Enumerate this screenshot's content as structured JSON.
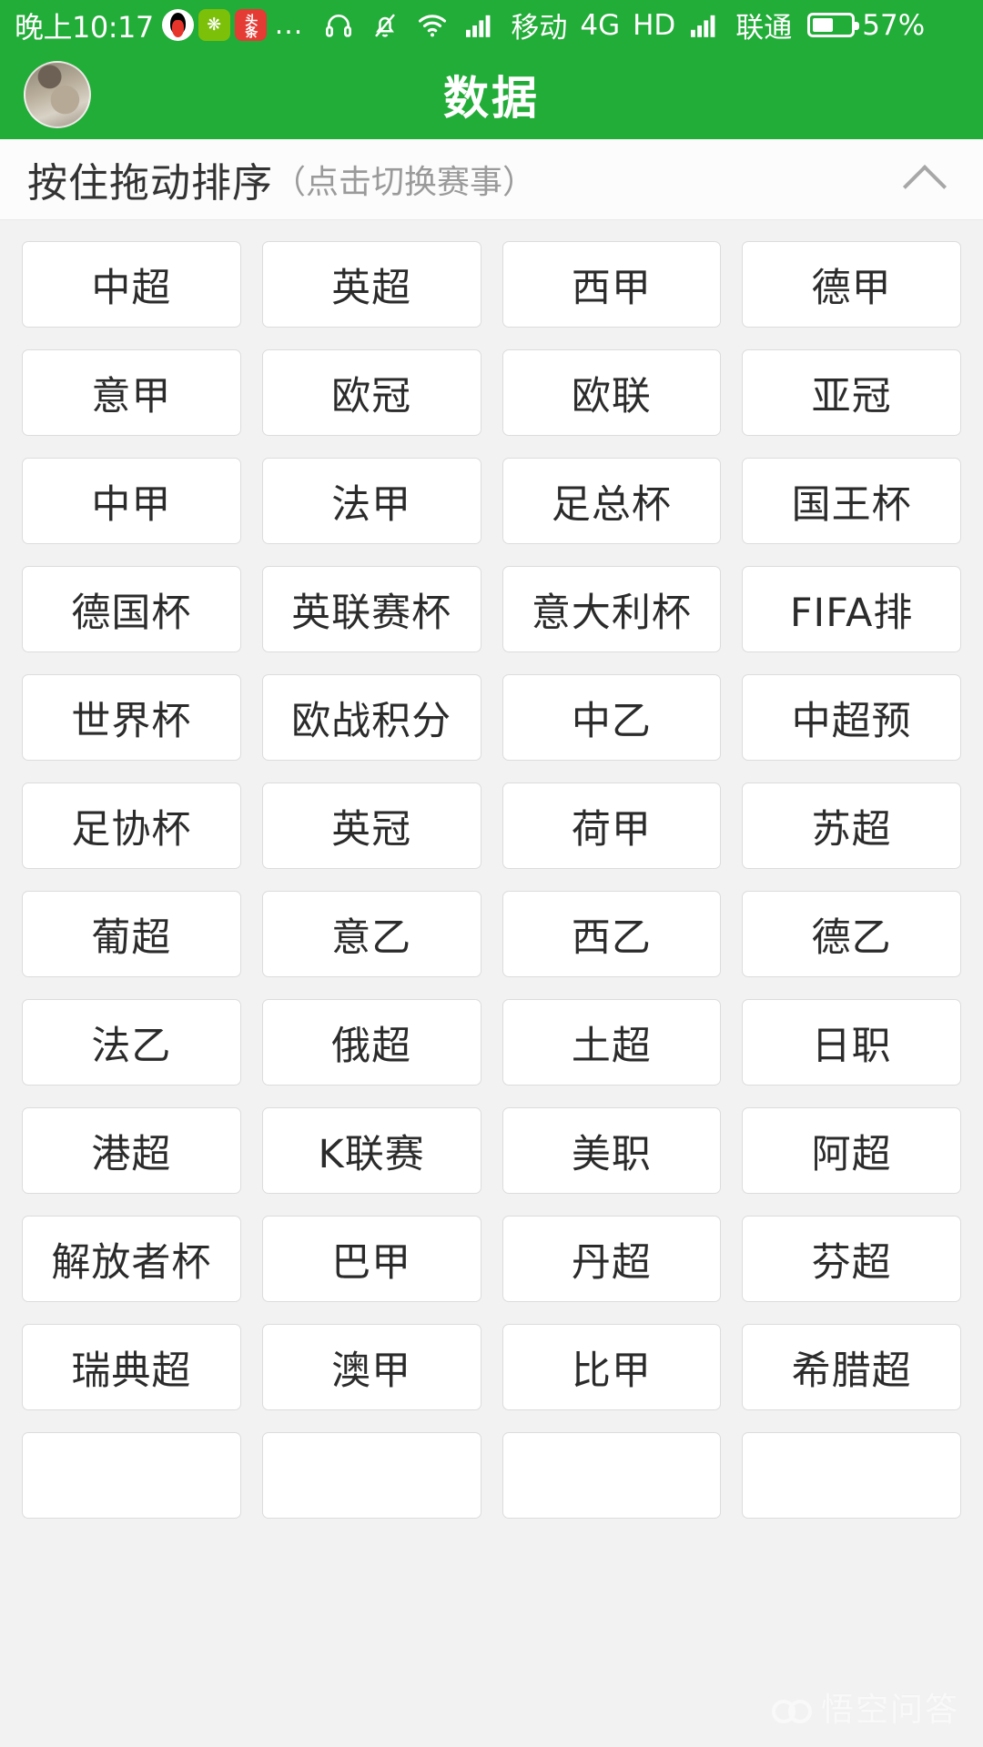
{
  "status_bar": {
    "time": "晚上10:17",
    "app_icons": [
      "qq-icon",
      "wechat-game-icon",
      "toutiao-icon"
    ],
    "overflow": "...",
    "icons": [
      "headphone-icon",
      "bell-muted-icon",
      "wifi-icon",
      "signal-icon"
    ],
    "carrier_1": "移动",
    "network": "4G",
    "hd": "HD",
    "carrier_2": "联通",
    "battery_percent": "57%"
  },
  "title_bar": {
    "title": "数据",
    "avatar": "user-avatar"
  },
  "sort_header": {
    "main_label": "按住拖动排序",
    "sub_label": "（点击切换赛事）",
    "collapse_icon": "chevron-up-icon"
  },
  "grid": {
    "columns": 4,
    "items": [
      "中超",
      "英超",
      "西甲",
      "德甲",
      "意甲",
      "欧冠",
      "欧联",
      "亚冠",
      "中甲",
      "法甲",
      "足总杯",
      "国王杯",
      "德国杯",
      "英联赛杯",
      "意大利杯",
      "FIFA排",
      "世界杯",
      "欧战积分",
      "中乙",
      "中超预",
      "足协杯",
      "英冠",
      "荷甲",
      "苏超",
      "葡超",
      "意乙",
      "西乙",
      "德乙",
      "法乙",
      "俄超",
      "土超",
      "日职",
      "港超",
      "K联赛",
      "美职",
      "阿超",
      "解放者杯",
      "巴甲",
      "丹超",
      "芬超",
      "瑞典超",
      "澳甲",
      "比甲",
      "希腊超",
      "",
      "",
      "",
      ""
    ]
  },
  "watermark": {
    "text": "悟空问答",
    "logo": "wukong-logo"
  },
  "colors": {
    "brand_green": "#22ac38",
    "page_background": "#f2f2f2",
    "cell_background": "#ffffff",
    "cell_border": "#dcdcdc",
    "primary_text": "#2b2b2b",
    "muted_text": "#9a9a9a"
  }
}
